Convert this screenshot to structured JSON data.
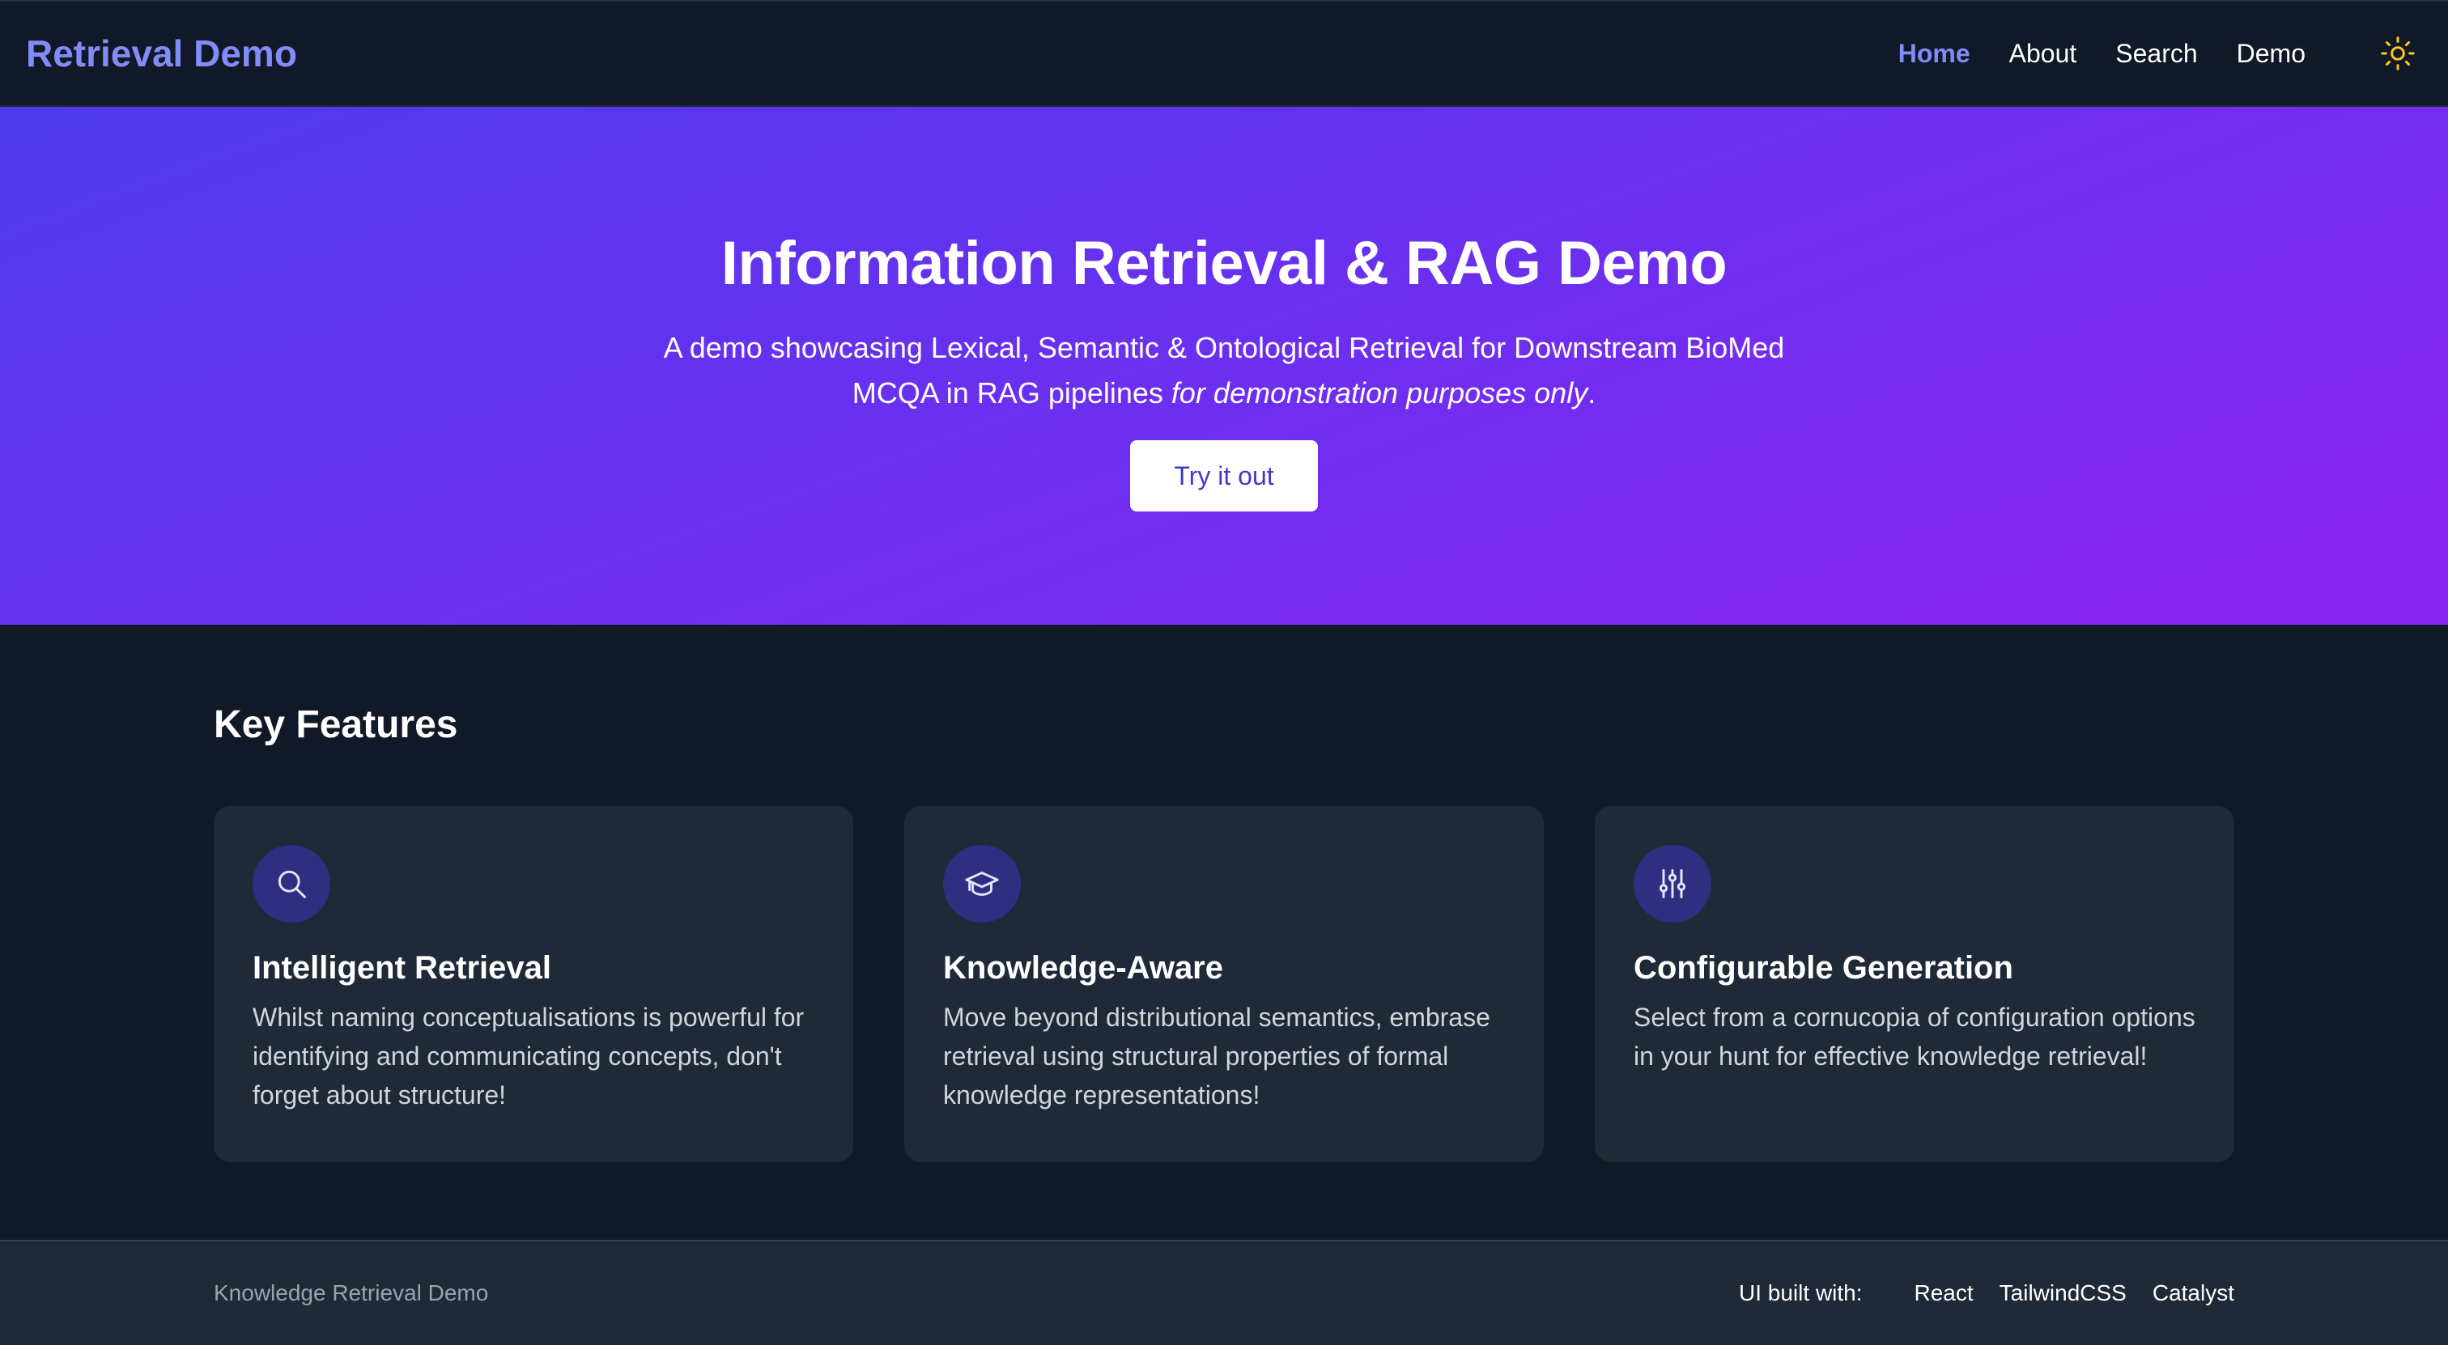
{
  "header": {
    "brand": "Retrieval Demo",
    "nav": [
      {
        "label": "Home",
        "active": true
      },
      {
        "label": "About",
        "active": false
      },
      {
        "label": "Search",
        "active": false
      },
      {
        "label": "Demo",
        "active": false
      }
    ],
    "theme_icon": "sun-icon"
  },
  "hero": {
    "title": "Information Retrieval & RAG Demo",
    "subtitle_main": "A demo showcasing Lexical, Semantic & Ontological Retrieval for Downstream BioMed MCQA in RAG pipelines ",
    "subtitle_emphasis": "for demonstration purposes only",
    "subtitle_end": ".",
    "cta_label": "Try it out"
  },
  "features": {
    "title": "Key Features",
    "cards": [
      {
        "icon": "search-icon",
        "title": "Intelligent Retrieval",
        "text": "Whilst naming conceptualisations is powerful for identifying and communicating concepts, don't forget about structure!"
      },
      {
        "icon": "graduation-cap-icon",
        "title": "Knowledge-Aware",
        "text": "Move beyond distributional semantics, embrase retrieval using structural properties of formal knowledge representations!"
      },
      {
        "icon": "sliders-icon",
        "title": "Configurable Generation",
        "text": "Select from a cornucopia of configuration options in your hunt for effective knowledge retrieval!"
      }
    ]
  },
  "footer": {
    "left": "Knowledge Retrieval Demo",
    "built_label": "UI built with:",
    "links": [
      "React",
      "TailwindCSS",
      "Catalyst"
    ]
  },
  "colors": {
    "background": "#111827",
    "card": "#1f2937",
    "accent": "#818cf8",
    "icon_circle": "#312e81",
    "hero_gradient_start": "#4f3bec",
    "hero_gradient_end": "#8a23f0",
    "sun": "#facc15"
  }
}
